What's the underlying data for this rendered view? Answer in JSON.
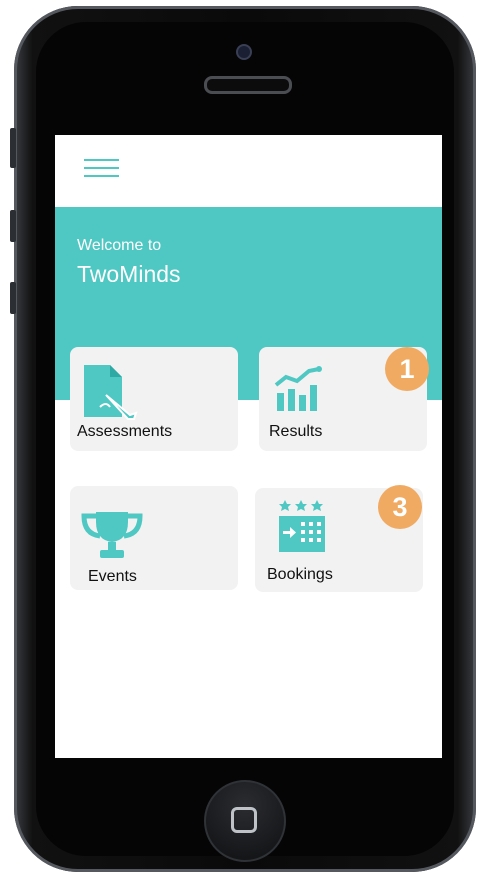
{
  "app": {
    "welcome": "Welcome to",
    "name": "TwoMinds"
  },
  "colors": {
    "accent": "#4fc8c3",
    "badge": "#f0aa62",
    "card": "#f2f2f2"
  },
  "tiles": [
    {
      "label": "Assessments",
      "icon": "assessment-document-icon",
      "badge": ""
    },
    {
      "label": "Results",
      "icon": "results-chart-icon",
      "badge": "1"
    },
    {
      "label": "Events",
      "icon": "trophy-icon",
      "badge": ""
    },
    {
      "label": "Bookings",
      "icon": "bookings-calendar-icon",
      "badge": "3"
    }
  ]
}
